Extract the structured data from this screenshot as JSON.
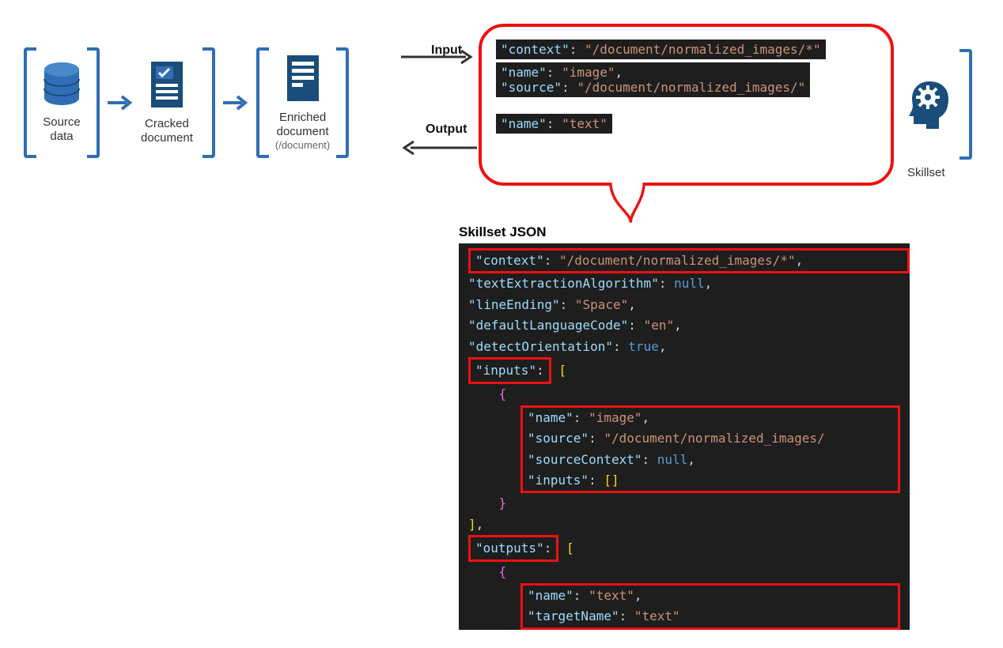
{
  "pipeline": {
    "source": {
      "title": "Source",
      "subtitle": "data"
    },
    "cracked": {
      "title": "Cracked",
      "subtitle": "document"
    },
    "enriched": {
      "title": "Enriched",
      "subtitle": "document",
      "path": "(/document)"
    },
    "skillset": {
      "title": "Skillset"
    }
  },
  "io": {
    "input": "Input",
    "output": "Output"
  },
  "callout": {
    "context_key": "\"context\"",
    "context_val": "\"/document/normalized_images/*\"",
    "name_key": "\"name\"",
    "name_val": "\"image\"",
    "source_key": "\"source\"",
    "source_val": "\"/document/normalized_images/\"",
    "out_name_key": "\"name\"",
    "out_name_val": "\"text\""
  },
  "json_title": "Skillset JSON",
  "json": {
    "l1": {
      "k": "\"context\"",
      "v": "\"/document/normalized_images/*\""
    },
    "l2": {
      "k": "\"textExtractionAlgorithm\"",
      "v": "null"
    },
    "l3": {
      "k": "\"lineEnding\"",
      "v": "\"Space\""
    },
    "l4": {
      "k": "\"defaultLanguageCode\"",
      "v": "\"en\""
    },
    "l5": {
      "k": "\"detectOrientation\"",
      "v": "true"
    },
    "l6": {
      "k": "\"inputs\""
    },
    "l7": {
      "k": "\"name\"",
      "v": "\"image\""
    },
    "l8": {
      "k": "\"source\"",
      "v": "\"/document/normalized_images/"
    },
    "l9": {
      "k": "\"sourceContext\"",
      "v": "null"
    },
    "l10": {
      "k": "\"inputs\"",
      "v": "[]"
    },
    "l11": {
      "k": "\"outputs\""
    },
    "l12": {
      "k": "\"name\"",
      "v": "\"text\""
    },
    "l13": {
      "k": "\"targetName\"",
      "v": "\"text\""
    }
  }
}
